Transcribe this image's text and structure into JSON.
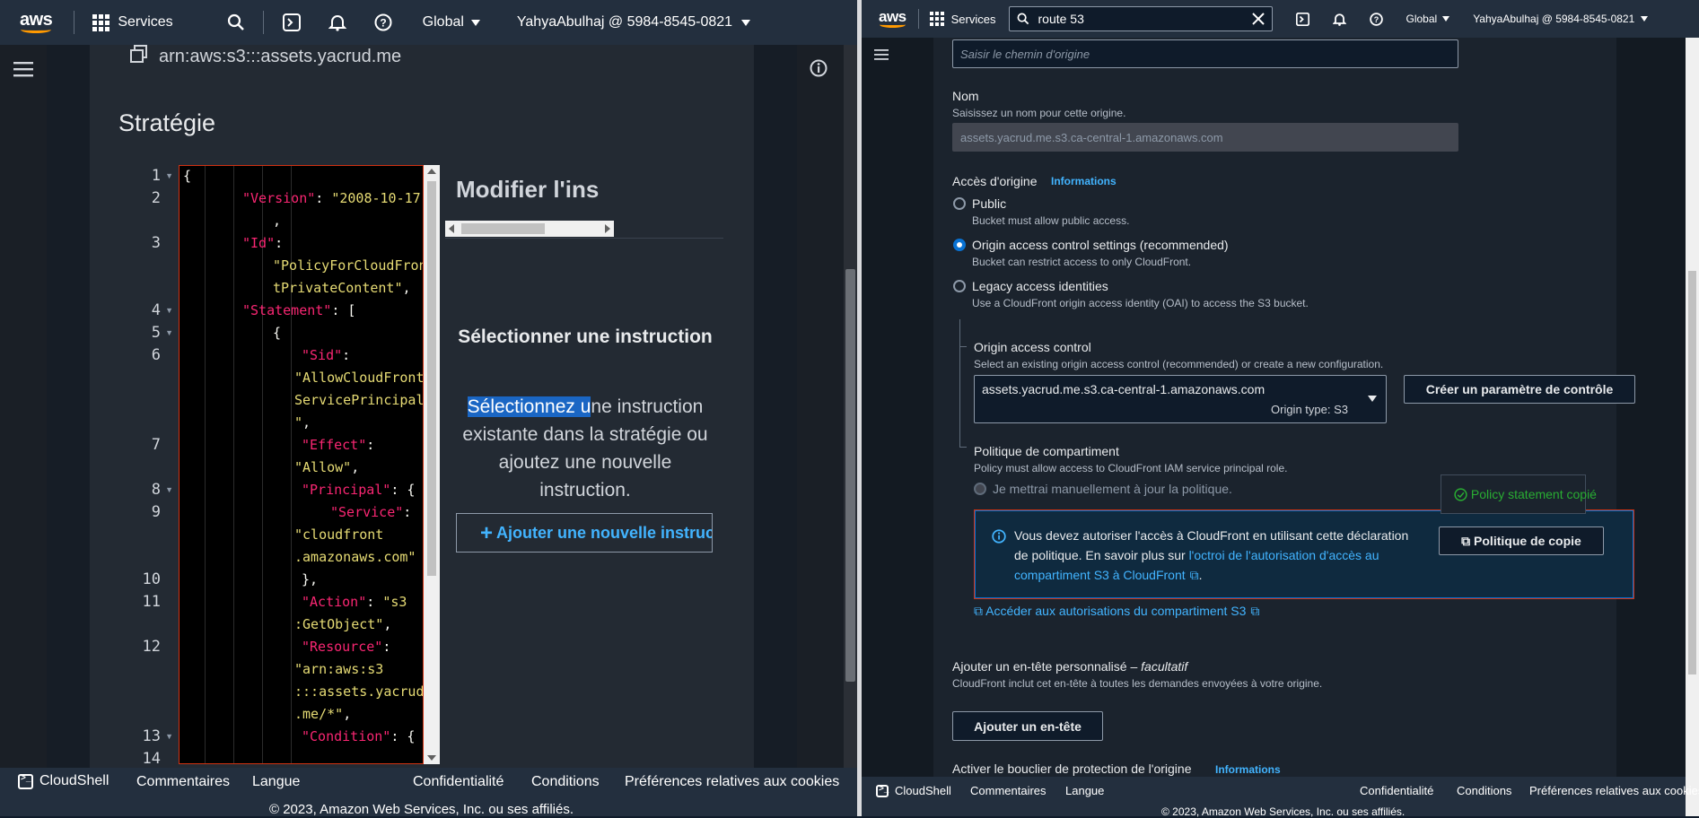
{
  "left": {
    "nav": {
      "logo": "aws",
      "services": "Services",
      "region": "Global",
      "account": "YahyaAbulhaj @ 5984-8545-0821"
    },
    "arn": "arn:aws:s3:::assets.yacrud.me",
    "section_title": "Stratégie",
    "editor": {
      "line_numbers": [
        "1",
        "2",
        "3",
        "4",
        "5",
        "6",
        "7",
        "8",
        "9",
        "10",
        "11",
        "12",
        "13",
        "14"
      ]
    },
    "panel": {
      "title": "Modifier l'ins",
      "empty_title": "Sélectionner une instruction",
      "empty_desc_highlight": "Sélectionnez u",
      "empty_desc_rest": "ne instruction existante dans la stratégie ou ajoutez une nouvelle instruction.",
      "add_button": "Ajouter une nouvelle instruction"
    },
    "footer": {
      "cloudshell": "CloudShell",
      "feedback": "Commentaires",
      "language": "Langue",
      "privacy": "Confidentialité",
      "terms": "Conditions",
      "cookies": "Préférences relatives aux cookies",
      "copyright": "© 2023, Amazon Web Services, Inc. ou ses affiliés."
    }
  },
  "right": {
    "nav": {
      "logo": "aws",
      "services": "Services",
      "search_value": "route 53",
      "region": "Global",
      "account": "YahyaAbulhaj @ 5984-8545-0821"
    },
    "origin_path_placeholder": "Saisir le chemin d'origine",
    "name": {
      "label": "Nom",
      "desc": "Saisissez un nom pour cette origine.",
      "value": "assets.yacrud.me.s3.ca-central-1.amazonaws.com"
    },
    "origin_access": {
      "label": "Accès d'origine",
      "info": "Informations",
      "options": [
        {
          "label": "Public",
          "desc": "Bucket must allow public access."
        },
        {
          "label": "Origin access control settings (recommended)",
          "desc": "Bucket can restrict access to only CloudFront."
        },
        {
          "label": "Legacy access identities",
          "desc": "Use a CloudFront origin access identity (OAI) to access the S3 bucket."
        }
      ]
    },
    "oac": {
      "label": "Origin access control",
      "desc": "Select an existing origin access control (recommended) or create a new configuration.",
      "selected": "assets.yacrud.me.s3.ca-central-1.amazonaws.com",
      "origin_type": "Origin type: S3",
      "create_button": "Créer un paramètre de contrôle"
    },
    "bucket_policy": {
      "label": "Politique de compartiment",
      "desc": "Policy must allow access to CloudFront IAM service principal role.",
      "option": "Je mettrai manuellement à jour la politique."
    },
    "tooltip": "Policy statement copié",
    "info_alert": {
      "line1": "Vous devez autoriser l'accès à CloudFront en utilisant cette déclaration",
      "line2_prefix": "de politique. En savoir plus sur ",
      "line2_link": "l'octroi de l'autorisation d'accès au",
      "line3_link": "compartiment S3 à CloudFront",
      "copy_button": "Politique de copie"
    },
    "bucket_permissions_link": "Accéder aux autorisations du compartiment S3",
    "custom_header": {
      "label": "Ajouter un en-tête personnalisé – ",
      "optional": "facultatif",
      "desc": "CloudFront inclut cet en-tête à toutes les demandes envoyées à votre origine.",
      "button": "Ajouter un en-tête"
    },
    "shield": {
      "label": "Activer le bouclier de protection de l'origine",
      "info": "Informations"
    },
    "footer": {
      "cloudshell": "CloudShell",
      "feedback": "Commentaires",
      "language": "Langue",
      "privacy": "Confidentialité",
      "terms": "Conditions",
      "cookies": "Préférences relatives aux cookies",
      "copyright": "© 2023, Amazon Web Services, Inc. ou ses affiliés."
    }
  },
  "colors": {
    "nav_bg": "#232f3e",
    "accent_orange": "#ff9900",
    "link_blue": "#42b4ff",
    "error_red": "#d13212",
    "success_green": "#29ad32"
  }
}
